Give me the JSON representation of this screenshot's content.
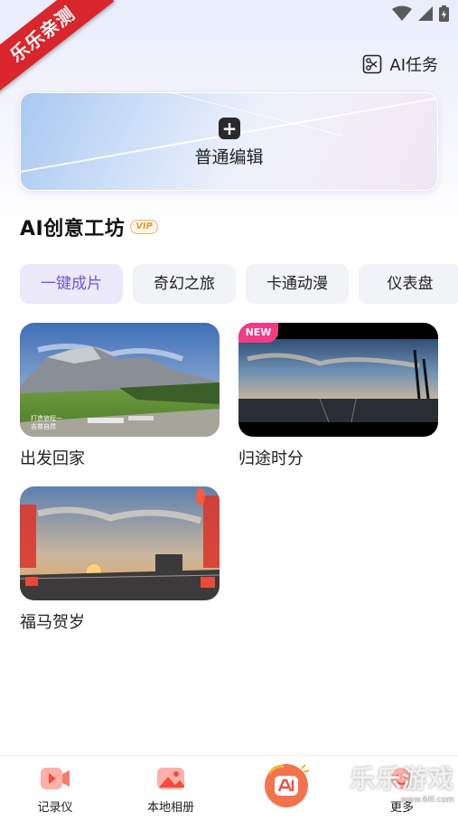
{
  "watermark": {
    "ribbon_text": "乐乐亲测",
    "corner_text": "乐乐游戏",
    "corner_url": "www.6lll.com"
  },
  "header": {
    "ai_task_label": "AI任务"
  },
  "edit_card": {
    "label": "普通编辑"
  },
  "section": {
    "title": "AI创意工坊",
    "badge": "VIP"
  },
  "tabs": [
    {
      "label": "一键成片",
      "active": true
    },
    {
      "label": "奇幻之旅",
      "active": false
    },
    {
      "label": "卡通动漫",
      "active": false
    },
    {
      "label": "仪表盘",
      "active": false
    }
  ],
  "templates": [
    {
      "label": "出发回家",
      "badge": ""
    },
    {
      "label": "归途时分",
      "badge": "NEW"
    },
    {
      "label": "福马贺岁",
      "badge": ""
    }
  ],
  "bottom_nav": [
    {
      "label": "记录仪",
      "icon": "video-camera-icon"
    },
    {
      "label": "本地相册",
      "icon": "gallery-icon"
    },
    {
      "label": "",
      "icon": "ai-center-icon"
    },
    {
      "label": "更多",
      "icon": "more-face-icon"
    }
  ],
  "colors": {
    "accent": "#6c57d8",
    "new_badge": "#f23b86",
    "brand_red": "#f04d3d"
  }
}
